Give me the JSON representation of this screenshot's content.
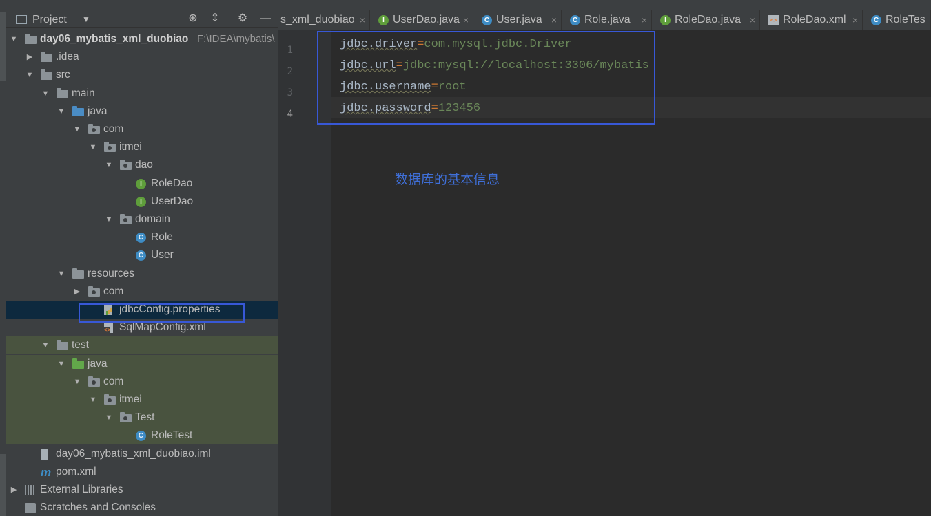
{
  "project_panel": {
    "title": "Project",
    "tree": [
      {
        "label": "day06_mybatis_xml_duobiao",
        "path": "F:\\IDEA\\mybatis\\",
        "icon": "module-folder-icon",
        "indent": 0,
        "arrow": "down",
        "bold": true
      },
      {
        "label": ".idea",
        "icon": "folder-icon",
        "indent": 1,
        "arrow": "right"
      },
      {
        "label": "src",
        "icon": "folder-icon",
        "indent": 1,
        "arrow": "down"
      },
      {
        "label": "main",
        "icon": "folder-icon",
        "indent": 2,
        "arrow": "down"
      },
      {
        "label": "java",
        "icon": "source-folder-icon",
        "indent": 3,
        "arrow": "down"
      },
      {
        "label": "com",
        "icon": "package-icon",
        "indent": 4,
        "arrow": "down"
      },
      {
        "label": "itmei",
        "icon": "package-icon",
        "indent": 5,
        "arrow": "down"
      },
      {
        "label": "dao",
        "icon": "package-icon",
        "indent": 6,
        "arrow": "down"
      },
      {
        "label": "RoleDao",
        "icon": "interface-icon",
        "indent": 7,
        "arrow": ""
      },
      {
        "label": "UserDao",
        "icon": "interface-icon",
        "indent": 7,
        "arrow": ""
      },
      {
        "label": "domain",
        "icon": "package-icon",
        "indent": 6,
        "arrow": "down"
      },
      {
        "label": "Role",
        "icon": "class-icon",
        "indent": 7,
        "arrow": ""
      },
      {
        "label": "User",
        "icon": "class-icon",
        "indent": 7,
        "arrow": ""
      },
      {
        "label": "resources",
        "icon": "resources-folder-icon",
        "indent": 3,
        "arrow": "down"
      },
      {
        "label": "com",
        "icon": "package-icon",
        "indent": 4,
        "arrow": "right"
      },
      {
        "label": "jdbcConfig.properties",
        "icon": "properties-file-icon",
        "indent": 5,
        "arrow": "",
        "selected": true
      },
      {
        "label": "SqlMapConfig.xml",
        "icon": "xml-file-icon",
        "indent": 5,
        "arrow": ""
      },
      {
        "label": "test",
        "icon": "folder-icon",
        "indent": 2,
        "arrow": "down",
        "test": true
      },
      {
        "label": "java",
        "icon": "test-source-folder-icon",
        "indent": 3,
        "arrow": "down",
        "test": true
      },
      {
        "label": "com",
        "icon": "package-icon",
        "indent": 4,
        "arrow": "down",
        "test": true
      },
      {
        "label": "itmei",
        "icon": "package-icon",
        "indent": 5,
        "arrow": "down",
        "test": true
      },
      {
        "label": "Test",
        "icon": "package-icon",
        "indent": 6,
        "arrow": "down",
        "test": true
      },
      {
        "label": "RoleTest",
        "icon": "class-icon",
        "indent": 7,
        "arrow": "",
        "test": true
      },
      {
        "label": "day06_mybatis_xml_duobiao.iml",
        "icon": "iml-file-icon",
        "indent": 1,
        "arrow": ""
      },
      {
        "label": "pom.xml",
        "icon": "maven-icon",
        "indent": 1,
        "arrow": ""
      },
      {
        "label": "External Libraries",
        "icon": "libraries-icon",
        "indent": 0,
        "arrow": "right"
      },
      {
        "label": "Scratches and Consoles",
        "icon": "scratches-icon",
        "indent": 0,
        "arrow": ""
      }
    ]
  },
  "tabs": [
    {
      "label": "s_xml_duobiao",
      "icon": "",
      "kind": "partial"
    },
    {
      "label": "UserDao.java",
      "icon": "I",
      "kind": "interface"
    },
    {
      "label": "User.java",
      "icon": "C",
      "kind": "class"
    },
    {
      "label": "Role.java",
      "icon": "C",
      "kind": "class"
    },
    {
      "label": "RoleDao.java",
      "icon": "I",
      "kind": "interface"
    },
    {
      "label": "RoleDao.xml",
      "icon": "",
      "kind": "xml"
    },
    {
      "label": "RoleTes",
      "icon": "C",
      "kind": "class"
    }
  ],
  "editor": {
    "line_numbers": [
      "1",
      "2",
      "3",
      "4"
    ],
    "lines": [
      {
        "key": "jdbc.driver",
        "sep": "=",
        "value": "com.mysql.jdbc.Driver"
      },
      {
        "key": "jdbc.url",
        "sep": "=",
        "value": "jdbc:mysql://localhost:3306/mybatis"
      },
      {
        "key": "jdbc.username",
        "sep": "=",
        "value": "root"
      },
      {
        "key": "jdbc.password",
        "sep": "=",
        "value": "123456"
      }
    ],
    "annotation": "数据库的基本信息"
  },
  "colors": {
    "annotation_box": "#3858d6",
    "annotation_text": "#3f6fd8",
    "property_value": "#6a8759"
  }
}
